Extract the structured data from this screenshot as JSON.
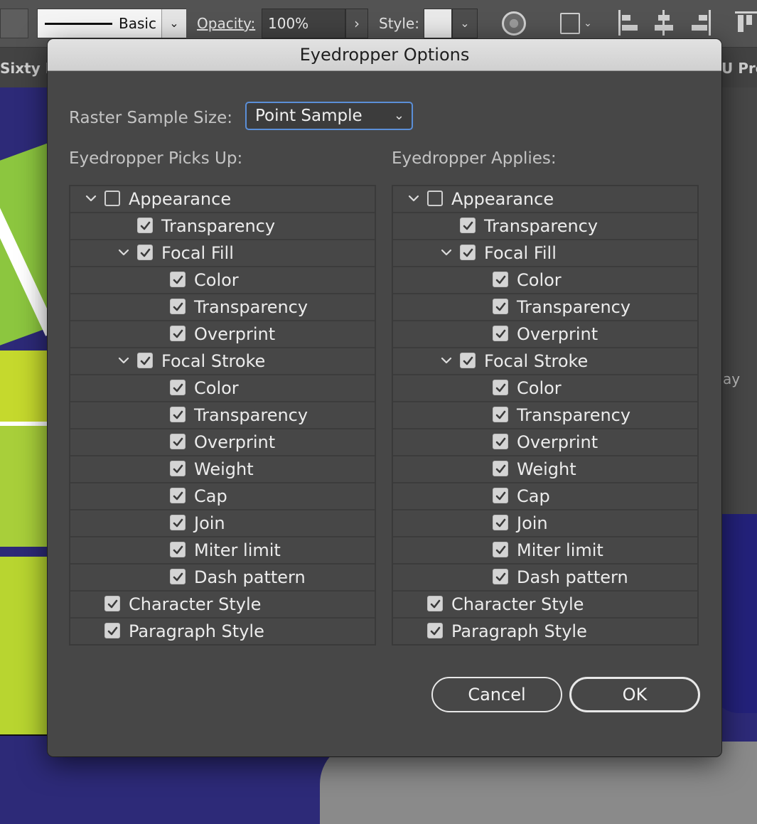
{
  "toolbar": {
    "stroke_profile": "Basic",
    "opacity_label": "Opacity:",
    "opacity_value": "100%",
    "style_label": "Style:"
  },
  "doc_tabs": {
    "left_tab": "Sixty F",
    "right_tab": "U Pre"
  },
  "canvas_fragment": "ay",
  "dialog": {
    "title": "Eyedropper Options",
    "raster_label": "Raster Sample Size:",
    "raster_value": "Point Sample",
    "picks_up_heading": "Eyedropper Picks Up:",
    "applies_heading": "Eyedropper Applies:",
    "picks_up": [
      {
        "label": "Appearance",
        "level": 0,
        "checked": false,
        "expandable": true
      },
      {
        "label": "Transparency",
        "level": 1,
        "checked": true,
        "expandable": false
      },
      {
        "label": "Focal Fill",
        "level": 1,
        "checked": true,
        "expandable": true
      },
      {
        "label": "Color",
        "level": 2,
        "checked": true,
        "expandable": false
      },
      {
        "label": "Transparency",
        "level": 2,
        "checked": true,
        "expandable": false
      },
      {
        "label": "Overprint",
        "level": 2,
        "checked": true,
        "expandable": false
      },
      {
        "label": "Focal Stroke",
        "level": 1,
        "checked": true,
        "expandable": true
      },
      {
        "label": "Color",
        "level": 2,
        "checked": true,
        "expandable": false
      },
      {
        "label": "Transparency",
        "level": 2,
        "checked": true,
        "expandable": false
      },
      {
        "label": "Overprint",
        "level": 2,
        "checked": true,
        "expandable": false
      },
      {
        "label": "Weight",
        "level": 2,
        "checked": true,
        "expandable": false
      },
      {
        "label": "Cap",
        "level": 2,
        "checked": true,
        "expandable": false
      },
      {
        "label": "Join",
        "level": 2,
        "checked": true,
        "expandable": false
      },
      {
        "label": "Miter limit",
        "level": 2,
        "checked": true,
        "expandable": false
      },
      {
        "label": "Dash pattern",
        "level": 2,
        "checked": true,
        "expandable": false
      },
      {
        "label": "Character Style",
        "level": 0,
        "checked": true,
        "expandable": false
      },
      {
        "label": "Paragraph Style",
        "level": 0,
        "checked": true,
        "expandable": false
      }
    ],
    "applies": [
      {
        "label": "Appearance",
        "level": 0,
        "checked": false,
        "expandable": true
      },
      {
        "label": "Transparency",
        "level": 1,
        "checked": true,
        "expandable": false
      },
      {
        "label": "Focal Fill",
        "level": 1,
        "checked": true,
        "expandable": true
      },
      {
        "label": "Color",
        "level": 2,
        "checked": true,
        "expandable": false
      },
      {
        "label": "Transparency",
        "level": 2,
        "checked": true,
        "expandable": false
      },
      {
        "label": "Overprint",
        "level": 2,
        "checked": true,
        "expandable": false
      },
      {
        "label": "Focal Stroke",
        "level": 1,
        "checked": true,
        "expandable": true
      },
      {
        "label": "Color",
        "level": 2,
        "checked": true,
        "expandable": false
      },
      {
        "label": "Transparency",
        "level": 2,
        "checked": true,
        "expandable": false
      },
      {
        "label": "Overprint",
        "level": 2,
        "checked": true,
        "expandable": false
      },
      {
        "label": "Weight",
        "level": 2,
        "checked": true,
        "expandable": false
      },
      {
        "label": "Cap",
        "level": 2,
        "checked": true,
        "expandable": false
      },
      {
        "label": "Join",
        "level": 2,
        "checked": true,
        "expandable": false
      },
      {
        "label": "Miter limit",
        "level": 2,
        "checked": true,
        "expandable": false
      },
      {
        "label": "Dash pattern",
        "level": 2,
        "checked": true,
        "expandable": false
      },
      {
        "label": "Character Style",
        "level": 0,
        "checked": true,
        "expandable": false
      },
      {
        "label": "Paragraph Style",
        "level": 0,
        "checked": true,
        "expandable": false
      }
    ],
    "cancel_label": "Cancel",
    "ok_label": "OK"
  },
  "colors": {
    "dialog_bg": "#474747",
    "canvas_bg": "#2d2a78",
    "accent_focus": "#5b8fd8",
    "artwork_green": "#8cc63f",
    "artwork_magenta": "#e6157a"
  }
}
